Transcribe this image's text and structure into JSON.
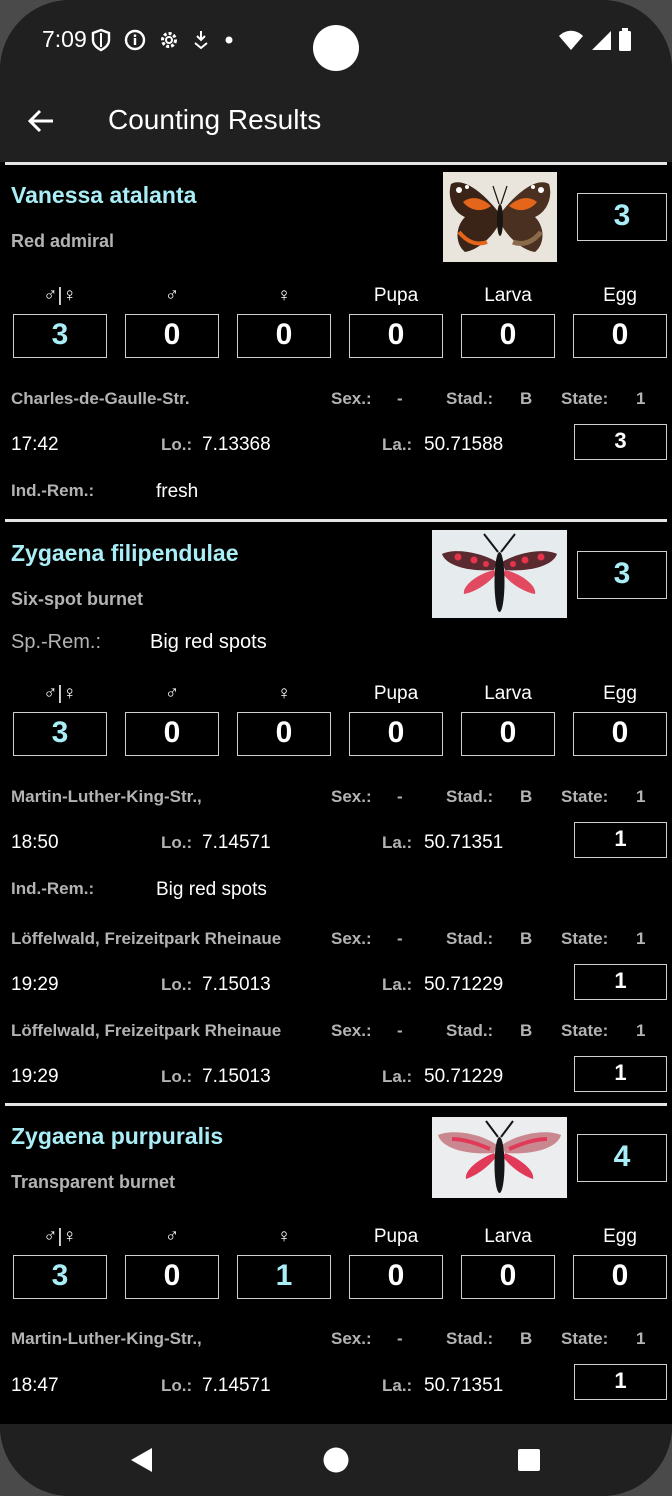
{
  "status_bar": {
    "time": "7:09"
  },
  "app_bar": {
    "title": "Counting Results"
  },
  "headers": {
    "sexes": "♂|♀",
    "male": "♂",
    "female": "♀",
    "pupa": "Pupa",
    "larva": "Larva",
    "egg": "Egg"
  },
  "labels": {
    "sex": "Sex.:",
    "stage": "Stad.:",
    "state": "State:",
    "lon": "Lo.:",
    "lat": "La.:",
    "ind_rem": "Ind.-Rem.:",
    "sp_rem": "Sp.-Rem.:"
  },
  "species": [
    {
      "name": "Vanessa atalanta",
      "common": "Red admiral",
      "total": "3",
      "counts": {
        "sexes": "3",
        "male": "0",
        "female": "0",
        "pupa": "0",
        "larva": "0",
        "egg": "0"
      },
      "records": [
        {
          "location": "Charles-de-Gaulle-Str.",
          "sex": "-",
          "stage": "B",
          "state": "1",
          "time": "17:42",
          "lon": "7.13368",
          "lat": "50.71588",
          "count": "3",
          "ind_rem": "fresh"
        }
      ]
    },
    {
      "name": "Zygaena filipendulae",
      "common": "Six-spot burnet",
      "total": "3",
      "sp_rem": "Big red spots",
      "counts": {
        "sexes": "3",
        "male": "0",
        "female": "0",
        "pupa": "0",
        "larva": "0",
        "egg": "0"
      },
      "records": [
        {
          "location": "Martin-Luther-King-Str.,",
          "sex": "-",
          "stage": "B",
          "state": "1",
          "time": "18:50",
          "lon": "7.14571",
          "lat": "50.71351",
          "count": "1",
          "ind_rem": "Big red spots"
        },
        {
          "location": "Löffelwald, Freizeitpark Rheinaue",
          "sex": "-",
          "stage": "B",
          "state": "1",
          "time": "19:29",
          "lon": "7.15013",
          "lat": "50.71229",
          "count": "1"
        },
        {
          "location": "Löffelwald, Freizeitpark Rheinaue",
          "sex": "-",
          "stage": "B",
          "state": "1",
          "time": "19:29",
          "lon": "7.15013",
          "lat": "50.71229",
          "count": "1"
        }
      ]
    },
    {
      "name": "Zygaena purpuralis",
      "common": "Transparent burnet",
      "total": "4",
      "counts": {
        "sexes": "3",
        "male": "0",
        "female": "1",
        "pupa": "0",
        "larva": "0",
        "egg": "0"
      },
      "records": [
        {
          "location": "Martin-Luther-King-Str.,",
          "sex": "-",
          "stage": "B",
          "state": "1",
          "time": "18:47",
          "lon": "7.14571",
          "lat": "50.71351",
          "count": "1"
        }
      ]
    }
  ],
  "colors": {
    "accent": "#a9eef6",
    "label_gray": "#b3b3b3",
    "bar": "#202020"
  },
  "icons": [
    "back-arrow-icon",
    "shield-icon",
    "info-icon",
    "gear-icon",
    "download-icon",
    "wifi-icon",
    "signal-icon",
    "battery-icon",
    "nav-back-icon",
    "nav-home-icon",
    "nav-recents-icon"
  ]
}
